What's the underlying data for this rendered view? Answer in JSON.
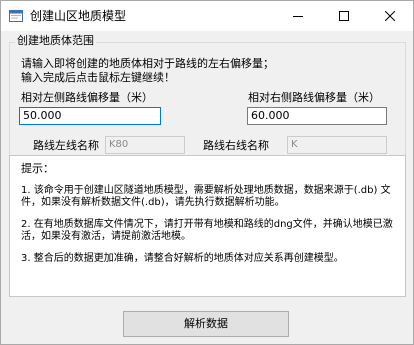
{
  "window": {
    "title": "创建山区地质模型",
    "icons": {
      "app": "app-form-icon",
      "minimize": "minimize-icon",
      "maximize": "maximize-icon",
      "close": "close-icon"
    }
  },
  "group": {
    "title": "创建地质体范围",
    "instruction_line1": "请输入即将创建的地质体相对于路线的左右偏移量；",
    "instruction_line2": "输入完成后点击鼠标左键继续！",
    "left_offset_label": "相对左侧路线偏移量（米）",
    "left_offset_value": "50.000",
    "right_offset_label": "相对右侧路线偏移量（米）",
    "right_offset_value": "60.000",
    "left_route_label": "路线左线名称",
    "left_route_value": "K80",
    "right_route_label": "路线右线名称",
    "right_route_value": "K"
  },
  "tips": {
    "heading": "提示：",
    "item1_line1": "1. 该命令用于创建山区隧道地质模型，需要解析处理地质数据，数据来源于(.db) 文",
    "item1_line2": "件，如果没有解析数据文件(.db)，请先执行数据解析功能。",
    "item2_line1": "2. 在有地质数据库文件情况下，请打开带有地模和路线的dng文件，并确认地模已激",
    "item2_line2": "活，如果没有激活，请提前激活地模。",
    "item3_line1": "3. 整合后的数据更加准确，请整合好解析的地质体对应关系再创建模型。"
  },
  "action": {
    "parse_button": "解析数据"
  }
}
